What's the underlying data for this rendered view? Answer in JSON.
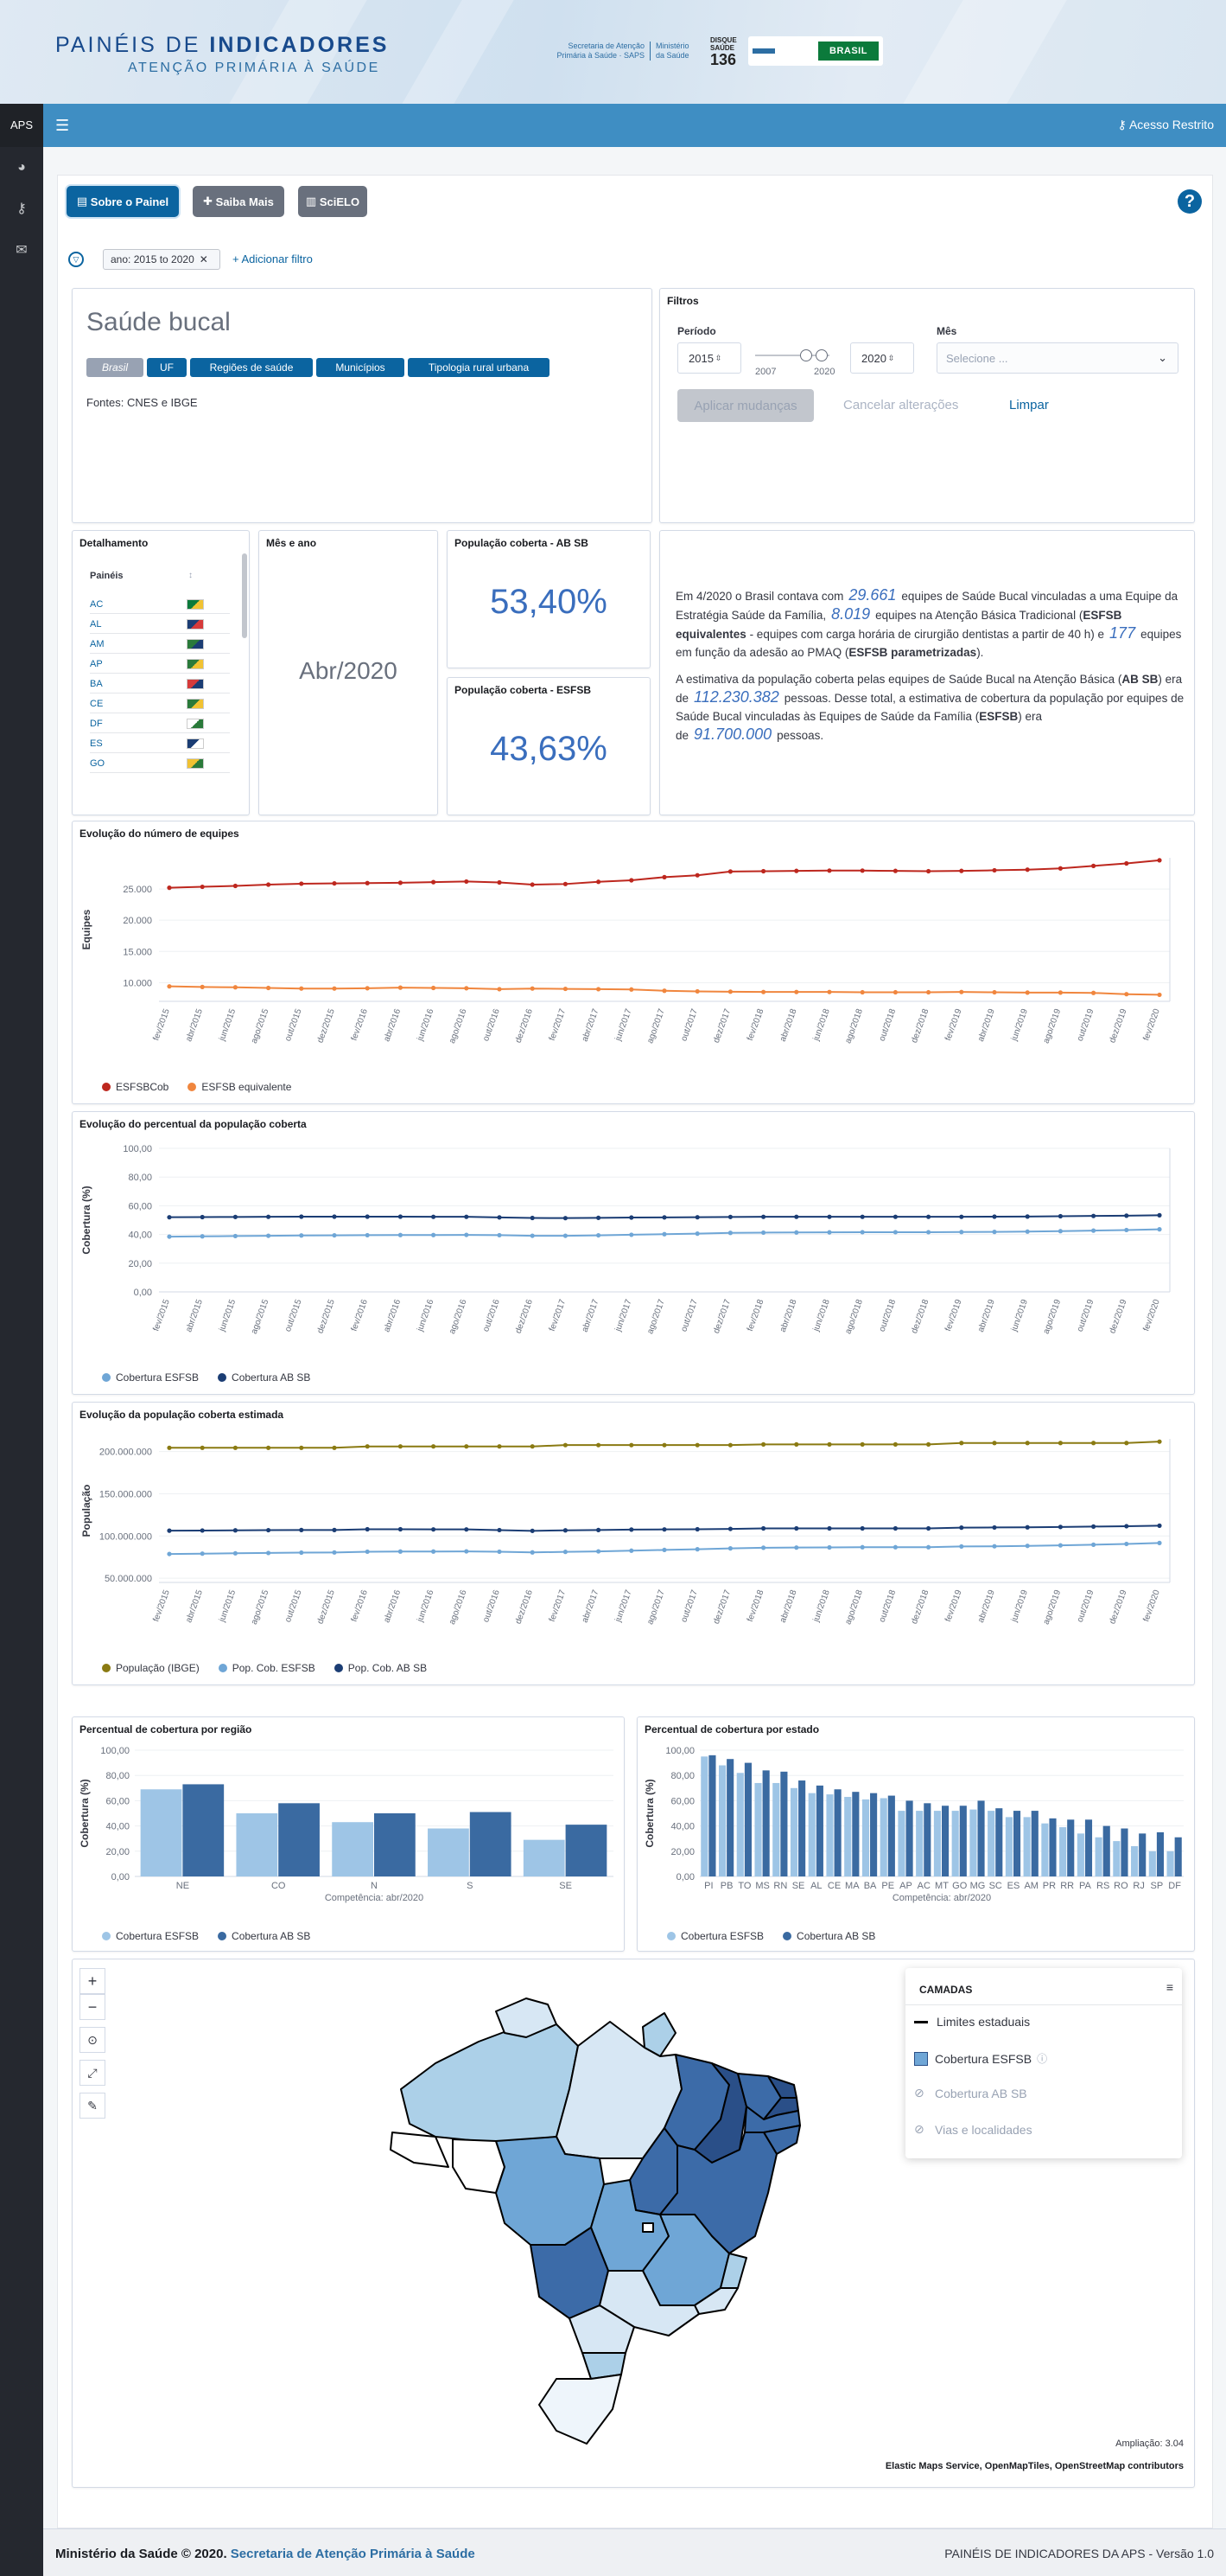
{
  "header": {
    "brand_prefix": "PAINÉIS DE ",
    "brand_bold": "INDICADORES",
    "brand_sub": "ATENÇÃO PRIMÁRIA À SAÚDE",
    "saps": "Secretaria de Atenção Primária à Saúde · SAPS",
    "ministerio": "Ministério da Saúde",
    "disque": "DISQUE SAÚDE",
    "disque_num": "136",
    "brasil": "BRASIL"
  },
  "topbar": {
    "acesso": "Acesso Restrito"
  },
  "sidebar": {
    "aps": "APS"
  },
  "buttons": {
    "sobre": "Sobre o Painel",
    "saiba": "Saiba Mais",
    "scielo": "SciELO"
  },
  "filter": {
    "pill": "ano: 2015 to 2020",
    "add": "+ Adicionar filtro"
  },
  "title_panel": {
    "title": "Saúde bucal",
    "tabs": [
      "Brasil",
      "UF",
      "Regiões de saúde",
      "Municípios",
      "Tipologia rural urbana"
    ],
    "fontes": "Fontes: CNES e IBGE"
  },
  "filtros": {
    "title": "Filtros",
    "periodo_label": "Período",
    "start": "2015",
    "end": "2020",
    "min": "2007",
    "max": "2020",
    "mes_label": "Mês",
    "mes_placeholder": "Selecione ...",
    "apply": "Aplicar mudanças",
    "cancel": "Cancelar alterações",
    "clear": "Limpar"
  },
  "detalhamento": {
    "title": "Detalhamento",
    "col1": "Painéis",
    "col2": "↕",
    "rows": [
      "AC",
      "AL",
      "AM",
      "AP",
      "BA",
      "CE",
      "DF",
      "ES",
      "GO"
    ]
  },
  "mes_ano": {
    "title": "Mês e ano",
    "value": "Abr/2020"
  },
  "pop_absb": {
    "title": "População coberta - AB SB",
    "value": "53,40%"
  },
  "pop_esfsb": {
    "title": "População coberta - ESFSB",
    "value": "43,63%"
  },
  "summary": {
    "p1_a": "Em 4/2020 o Brasil contava com",
    "n1": "29.661",
    "p1_b": "equipes de Saúde Bucal vinculadas a uma Equipe da Estratégia Saúde da Família,",
    "n2": "8.019",
    "p1_c": "equipes na Atenção Básica Tradicional (",
    "b1": "ESFSB equivalentes",
    "p1_d": "- equipes com carga horária de cirurgião dentistas a partir de 40 h) e",
    "n3": "177",
    "p1_e": "equipes em função da adesão ao PMAQ (",
    "b2": "ESFSB parametrizadas",
    "p1_f": ").",
    "p2_a": "A estimativa da população coberta pelas equipes de Saúde Bucal na Atenção Básica (",
    "b3": "AB SB",
    "p2_b": ") era de",
    "n4": "112.230.382",
    "p2_c": "pessoas. Desse total, a estimativa de cobertura da população por equipes de Saúde Bucal vinculadas às Equipes de Saúde da Família (",
    "b4": "ESFSB",
    "p2_d": ") era de",
    "n5": "91.700.000",
    "p2_e": "pessoas."
  },
  "chart_titles": {
    "c1": "Evolução do número de equipes",
    "c2": "Evolução do percentual da população coberta",
    "c3": "Evolução da população coberta estimada",
    "c4": "Percentual de cobertura por região",
    "c5": "Percentual de cobertura por estado"
  },
  "chart_data": [
    {
      "type": "line",
      "title": "Evolução do número de equipes",
      "ylabel": "Equipes",
      "ylim": [
        7000,
        30000
      ],
      "yticks": [
        "10.000",
        "15.000",
        "20.000",
        "25.000"
      ],
      "x": [
        "fev/2015",
        "abr/2015",
        "jun/2015",
        "ago/2015",
        "out/2015",
        "dez/2015",
        "fev/2016",
        "abr/2016",
        "jun/2016",
        "ago/2016",
        "out/2016",
        "dez/2016",
        "fev/2017",
        "abr/2017",
        "jun/2017",
        "ago/2017",
        "out/2017",
        "dez/2017",
        "fev/2018",
        "abr/2018",
        "jun/2018",
        "ago/2018",
        "out/2018",
        "dez/2018",
        "fev/2019",
        "abr/2019",
        "jun/2019",
        "ago/2019",
        "out/2019",
        "dez/2019",
        "fev/2020"
      ],
      "series": [
        {
          "name": "ESFSBCob",
          "color": "#bd271e",
          "values": [
            25200,
            25350,
            25500,
            25700,
            25850,
            25900,
            25950,
            26000,
            26100,
            26200,
            26050,
            25700,
            25800,
            26150,
            26400,
            26900,
            27200,
            27800,
            27850,
            27900,
            27950,
            27950,
            27900,
            27850,
            27900,
            28000,
            28100,
            28300,
            28700,
            29100,
            29600
          ]
        },
        {
          "name": "ESFSB equivalente",
          "color": "#f0863e",
          "values": [
            9400,
            9300,
            9250,
            9150,
            9050,
            9050,
            9100,
            9200,
            9150,
            9100,
            8950,
            9050,
            9000,
            8950,
            8900,
            8700,
            8600,
            8550,
            8500,
            8500,
            8500,
            8450,
            8450,
            8450,
            8500,
            8450,
            8400,
            8400,
            8350,
            8150,
            8050
          ]
        }
      ]
    },
    {
      "type": "line",
      "title": "Evolução do percentual da população coberta",
      "ylabel": "Cobertura (%)",
      "ylim": [
        0,
        100
      ],
      "yticks": [
        "0,00",
        "20,00",
        "40,00",
        "60,00",
        "80,00",
        "100,00"
      ],
      "x": [
        "fev/2015",
        "abr/2015",
        "jun/2015",
        "ago/2015",
        "out/2015",
        "dez/2015",
        "fev/2016",
        "abr/2016",
        "jun/2016",
        "ago/2016",
        "out/2016",
        "dez/2016",
        "fev/2017",
        "abr/2017",
        "jun/2017",
        "ago/2017",
        "out/2017",
        "dez/2017",
        "fev/2018",
        "abr/2018",
        "jun/2018",
        "ago/2018",
        "out/2018",
        "dez/2018",
        "fev/2019",
        "abr/2019",
        "jun/2019",
        "ago/2019",
        "out/2019",
        "dez/2019",
        "fev/2020"
      ],
      "series": [
        {
          "name": "Cobertura ESFSB",
          "color": "#6fa6d6",
          "values": [
            38.5,
            38.7,
            38.9,
            39.1,
            39.3,
            39.4,
            39.5,
            39.6,
            39.6,
            39.7,
            39.5,
            39.1,
            39.1,
            39.4,
            39.8,
            40.2,
            40.6,
            41.1,
            41.3,
            41.4,
            41.5,
            41.6,
            41.6,
            41.6,
            41.7,
            41.8,
            42.0,
            42.3,
            42.7,
            43.1,
            43.6
          ]
        },
        {
          "name": "Cobertura AB SB",
          "color": "#1b3d74",
          "values": [
            52.0,
            52.1,
            52.2,
            52.3,
            52.4,
            52.4,
            52.4,
            52.4,
            52.3,
            52.3,
            51.9,
            51.5,
            51.4,
            51.6,
            51.8,
            51.9,
            52.0,
            52.2,
            52.3,
            52.3,
            52.3,
            52.3,
            52.3,
            52.3,
            52.3,
            52.4,
            52.5,
            52.7,
            52.9,
            53.1,
            53.4
          ]
        }
      ]
    },
    {
      "type": "line",
      "title": "Evolução da população coberta estimada",
      "ylabel": "População",
      "ylim": [
        45000000,
        215000000
      ],
      "yticks": [
        "50.000.000",
        "100.000.000",
        "150.000.000",
        "200.000.000"
      ],
      "x": [
        "fev/2015",
        "abr/2015",
        "jun/2015",
        "ago/2015",
        "out/2015",
        "dez/2015",
        "fev/2016",
        "abr/2016",
        "jun/2016",
        "ago/2016",
        "out/2016",
        "dez/2016",
        "fev/2017",
        "abr/2017",
        "jun/2017",
        "ago/2017",
        "out/2017",
        "dez/2017",
        "fev/2018",
        "abr/2018",
        "jun/2018",
        "ago/2018",
        "out/2018",
        "dez/2018",
        "fev/2019",
        "abr/2019",
        "jun/2019",
        "ago/2019",
        "out/2019",
        "dez/2019",
        "fev/2020"
      ],
      "series": [
        {
          "name": "População (IBGE)",
          "color": "#8a7a12",
          "values": [
            204450000,
            204450000,
            204450000,
            204450000,
            204450000,
            204450000,
            206080000,
            206080000,
            206080000,
            206080000,
            206080000,
            206080000,
            207660000,
            207660000,
            207660000,
            207660000,
            207660000,
            207660000,
            208490000,
            208490000,
            208490000,
            208490000,
            208490000,
            208490000,
            210150000,
            210150000,
            210150000,
            210150000,
            210150000,
            210150000,
            211750000
          ]
        },
        {
          "name": "Pop. Cob. ESFSB",
          "color": "#6fa6d6",
          "values": [
            78700000,
            79100000,
            79500000,
            79900000,
            80300000,
            80500000,
            81400000,
            81600000,
            81600000,
            81800000,
            81400000,
            80600000,
            81200000,
            81800000,
            82600000,
            83500000,
            84300000,
            85300000,
            86100000,
            86300000,
            86500000,
            86700000,
            86700000,
            86700000,
            87600000,
            87800000,
            88300000,
            88900000,
            89700000,
            90600000,
            91700000
          ]
        },
        {
          "name": "Pop. Cob. AB SB",
          "color": "#1b3d74",
          "values": [
            106300000,
            106500000,
            106700000,
            106900000,
            107100000,
            107100000,
            108000000,
            108000000,
            107800000,
            107800000,
            107000000,
            106100000,
            106700000,
            107100000,
            107600000,
            107800000,
            108000000,
            108400000,
            109000000,
            109000000,
            109000000,
            109000000,
            109000000,
            109000000,
            109900000,
            110100000,
            110300000,
            110700000,
            111200000,
            111600000,
            112230000
          ]
        }
      ]
    },
    {
      "type": "bar",
      "title": "Percentual de cobertura por região",
      "ylabel": "Cobertura (%)",
      "xlabel": "Competência: abr/2020",
      "ylim": [
        0,
        100
      ],
      "yticks": [
        "0,00",
        "20,00",
        "40,00",
        "60,00",
        "80,00",
        "100,00"
      ],
      "categories": [
        "NE",
        "CO",
        "N",
        "S",
        "SE"
      ],
      "series": [
        {
          "name": "Cobertura ESFSB",
          "color": "#9ec5e6",
          "values": [
            69,
            50,
            43,
            38,
            29
          ]
        },
        {
          "name": "Cobertura AB SB",
          "color": "#3a6aa1",
          "values": [
            73,
            58,
            50,
            51,
            41
          ]
        }
      ]
    },
    {
      "type": "bar",
      "title": "Percentual de cobertura por estado",
      "ylabel": "Cobertura (%)",
      "xlabel": "Competência: abr/2020",
      "ylim": [
        0,
        100
      ],
      "yticks": [
        "0,00",
        "20,00",
        "40,00",
        "60,00",
        "80,00",
        "100,00"
      ],
      "categories": [
        "PI",
        "PB",
        "TO",
        "MS",
        "RN",
        "SE",
        "AL",
        "CE",
        "MA",
        "BA",
        "PE",
        "AP",
        "AC",
        "MT",
        "GO",
        "MG",
        "SC",
        "ES",
        "AM",
        "PR",
        "RR",
        "PA",
        "RS",
        "RO",
        "RJ",
        "SP",
        "DF"
      ],
      "series": [
        {
          "name": "Cobertura ESFSB",
          "color": "#9ec5e6",
          "values": [
            95,
            88,
            82,
            74,
            74,
            70,
            66,
            65,
            63,
            61,
            62,
            52,
            52,
            52,
            52,
            53,
            52,
            47,
            47,
            42,
            39,
            34,
            31,
            28,
            24,
            20,
            20
          ]
        },
        {
          "name": "Cobertura AB SB",
          "color": "#3a6aa1",
          "values": [
            96,
            93,
            90,
            84,
            83,
            76,
            72,
            69,
            67,
            66,
            64,
            60,
            58,
            56,
            56,
            60,
            54,
            52,
            52,
            46,
            45,
            45,
            40,
            38,
            34,
            35,
            31
          ]
        }
      ]
    }
  ],
  "map": {
    "camadas": "CAMADAS",
    "layers": [
      "Limites estaduais",
      "Cobertura ESFSB",
      "Cobertura AB SB",
      "Vias e localidades"
    ],
    "ampliacao": "Ampliação: 3.04",
    "credits": "Elastic Maps Service, OpenMapTiles, OpenStreetMap contributors"
  },
  "footer": {
    "left": "Ministério da Saúde © 2020.",
    "link": "Secretaria de Atenção Primária à Saúde",
    "right": "PAINÉIS DE INDICADORES DA APS - Versão 1.0"
  }
}
